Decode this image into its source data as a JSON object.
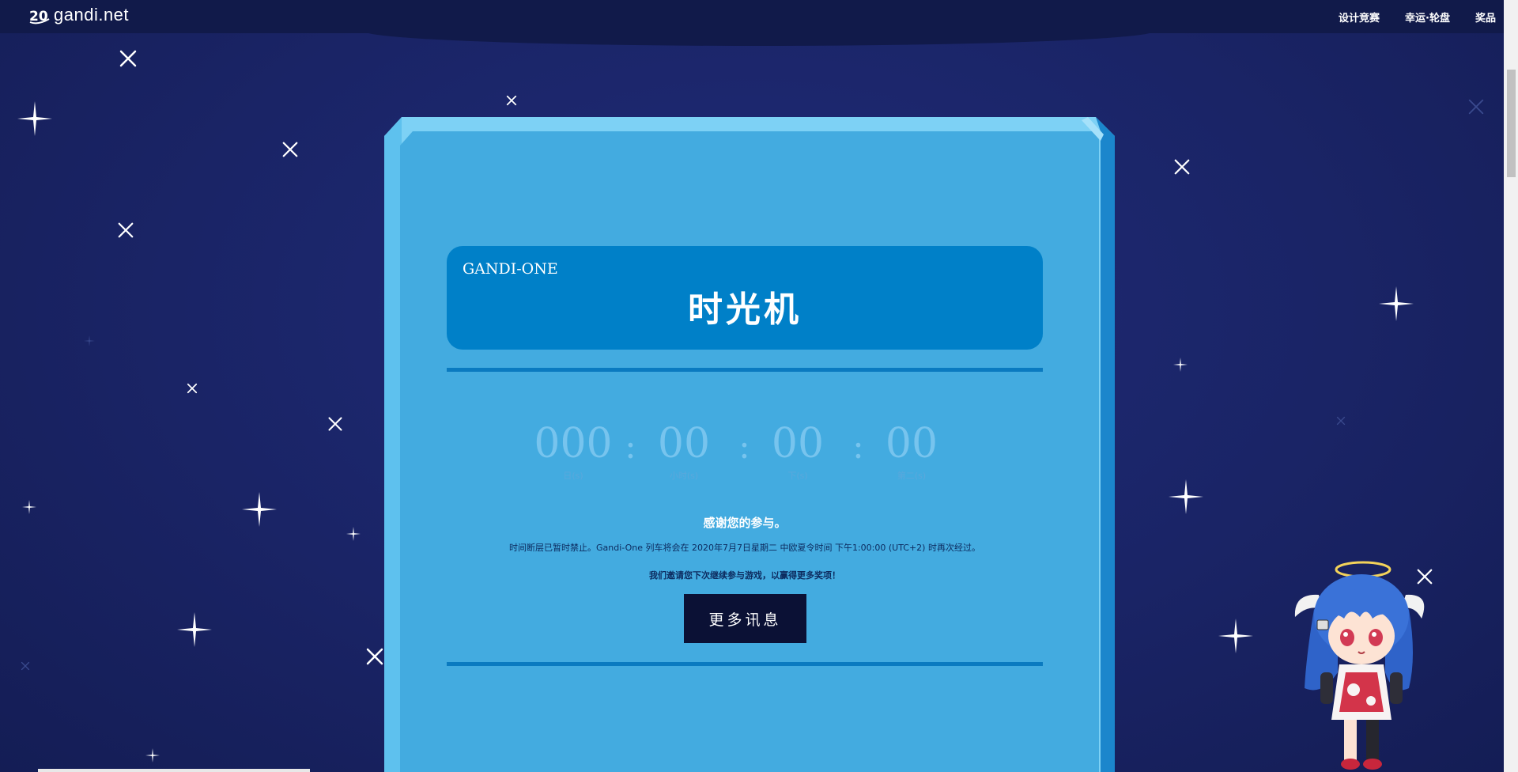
{
  "header": {
    "logo_text": "gandi.net",
    "logo_badge": "20",
    "nav": [
      {
        "label": "设计竞赛"
      },
      {
        "label": "幸运·轮盘"
      },
      {
        "label": "奖品"
      }
    ]
  },
  "main": {
    "subtitle": "GANDI-ONE",
    "title": "时光机",
    "countdown": [
      {
        "value": "000",
        "label": "日(s)"
      },
      {
        "value": "00",
        "label": "小时(s)"
      },
      {
        "value": "00",
        "label": "下(s)"
      },
      {
        "value": "00",
        "label": "第二(s)"
      }
    ],
    "separator": ":",
    "thanks": "感谢您的参与。",
    "info": "时间断层已暂时禁止。Gandi-One 列车将会在 2020年7月7日星期二 中欧夏令时间 下午1:00:00 (UTC+2) 时再次经过。",
    "invite": "我们邀请您下次继续参与游戏，以赢得更多奖项！",
    "more_button": "更多讯息"
  },
  "colors": {
    "background": "#1a2466",
    "panel": "#43abe0",
    "panel_dark": "#1a8ad0",
    "title_box": "#0080c8",
    "button": "#0b1135"
  }
}
